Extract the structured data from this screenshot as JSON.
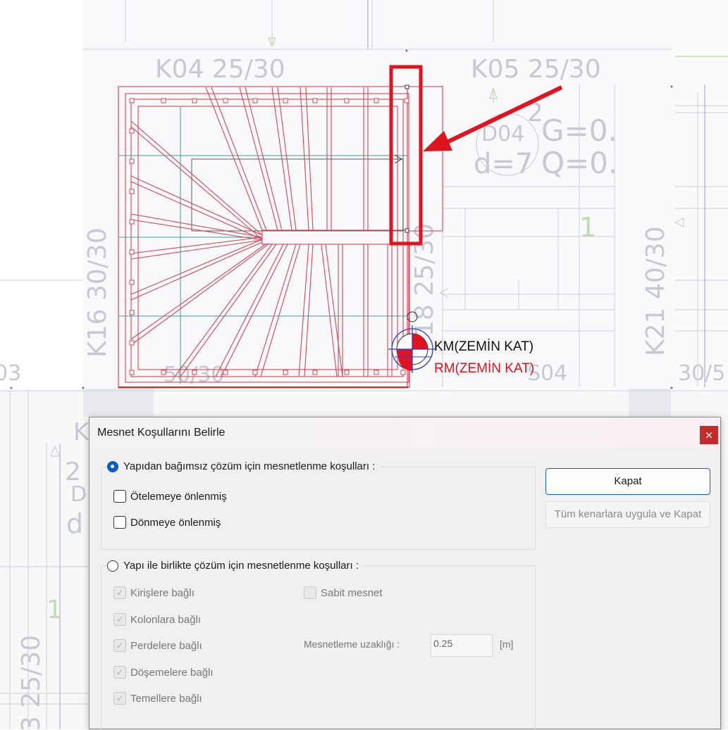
{
  "canvas": {
    "labels": {
      "k04": "K04 25/30",
      "k05": "K05 25/30",
      "k16": "K16 30/30",
      "k21": "K21 40/30",
      "k18": "18 25/30",
      "d04": "D04",
      "d7": "d=7",
      "g": "G=0.",
      "q": "Q=0.",
      "two": "2",
      "one": "1",
      "b50": "50/30",
      "s04": "S04",
      "left03": "03",
      "right305": "30/5",
      "km": "KM(ZEMİN KAT)",
      "rm": "RM(ZEMİN KAT)",
      "bottom_left": "3 25/30",
      "bl_two": "2",
      "bl_d": "D",
      "bl_d2": "d",
      "bl_one": "1",
      "bl_k": "K"
    }
  },
  "dialog": {
    "title": "Mesnet Koşullarını Belirle",
    "close_label": "×",
    "group1": {
      "label": "Yapıdan bağımsız çözüm için mesnetlenme koşulları  :",
      "selected": true,
      "options": [
        {
          "label": "Ötelemeye önlenmiş",
          "checked": false
        },
        {
          "label": "Dönmeye önlenmiş",
          "checked": false
        }
      ]
    },
    "group2": {
      "label": "Yapı ile birlikte çözüm için mesnetlenme koşulları  :",
      "selected": false,
      "options": [
        {
          "label": "Kirişlere bağlı",
          "checked": true
        },
        {
          "label": "Kolonlara bağlı",
          "checked": true
        },
        {
          "label": "Perdelere bağlı",
          "checked": true
        },
        {
          "label": "Döşemelere bağlı",
          "checked": true
        },
        {
          "label": "Temellere bağlı",
          "checked": true
        }
      ],
      "fixed_support": {
        "label": "Sabit mesnet",
        "checked": false
      },
      "distance": {
        "label": "Mesnetleme uzaklığı :",
        "value": "0.25",
        "unit": "[m]"
      }
    },
    "buttons": {
      "close": "Kapat",
      "apply_all": "Tüm kenarlara uygula ve Kapat"
    }
  },
  "colors": {
    "accent": "#0b5cc9",
    "highlight": "#e0141e",
    "stair_lines": "#d94452",
    "drawing_gray": "#c8cad8",
    "dialog_bg": "#f0f0f0"
  }
}
